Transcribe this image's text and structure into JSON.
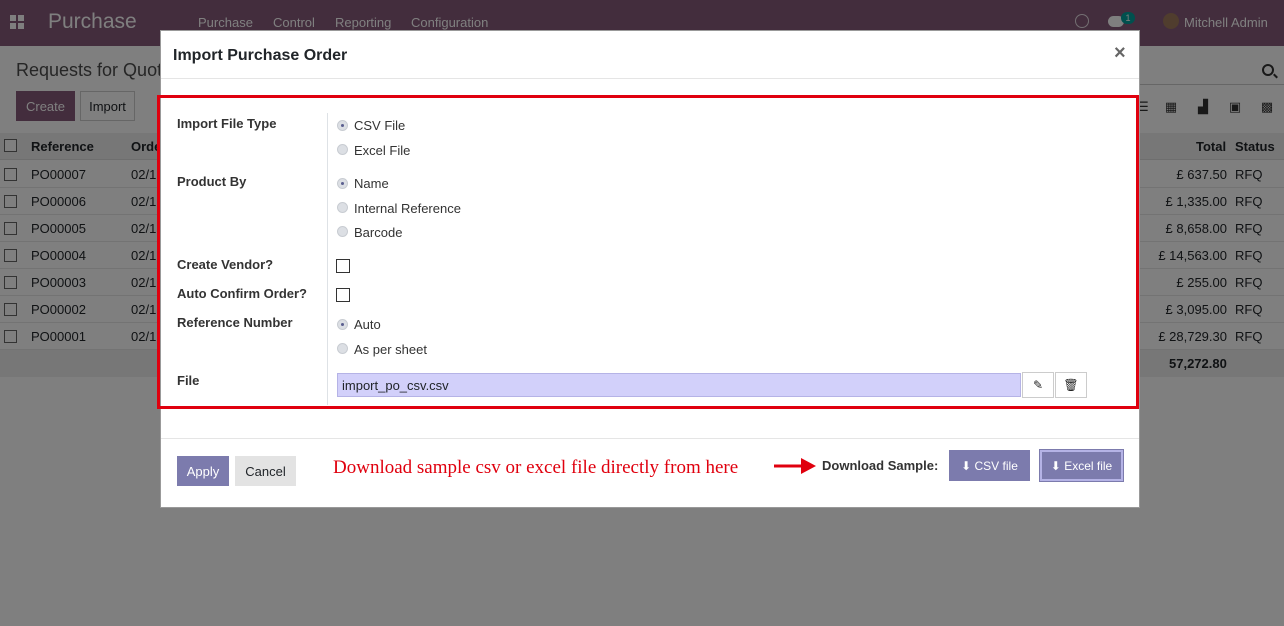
{
  "navbar": {
    "app_name": "Purchase",
    "menu": [
      "Purchase",
      "Control",
      "Reporting",
      "Configuration"
    ],
    "notification_count": "1",
    "user": "Mitchell Admin"
  },
  "control_panel": {
    "title": "Requests for Quot",
    "create_label": "Create",
    "import_label": "Import"
  },
  "list": {
    "headers": {
      "reference": "Reference",
      "order": "Orde",
      "total": "Total",
      "status": "Status"
    },
    "rows": [
      {
        "ref": "PO00007",
        "date": "02/1",
        "total": "£ 637.50",
        "status": "RFQ"
      },
      {
        "ref": "PO00006",
        "date": "02/1",
        "total": "£ 1,335.00",
        "status": "RFQ"
      },
      {
        "ref": "PO00005",
        "date": "02/1",
        "total": "£ 8,658.00",
        "status": "RFQ"
      },
      {
        "ref": "PO00004",
        "date": "02/1",
        "total": "£ 14,563.00",
        "status": "RFQ"
      },
      {
        "ref": "PO00003",
        "date": "02/1",
        "total": "£ 255.00",
        "status": "RFQ"
      },
      {
        "ref": "PO00002",
        "date": "02/1",
        "total": "£ 3,095.00",
        "status": "RFQ"
      },
      {
        "ref": "PO00001",
        "date": "02/1",
        "total": "£ 28,729.30",
        "status": "RFQ"
      }
    ],
    "grand_total": "57,272.80"
  },
  "modal": {
    "title": "Import Purchase Order",
    "close": "×",
    "import_file_type": {
      "label": "Import File Type",
      "options": [
        "CSV File",
        "Excel File"
      ],
      "selected": "CSV File"
    },
    "product_by": {
      "label": "Product By",
      "options": [
        "Name",
        "Internal Reference",
        "Barcode"
      ],
      "selected": "Name"
    },
    "create_vendor": {
      "label": "Create Vendor?",
      "checked": false
    },
    "auto_confirm": {
      "label": "Auto Confirm Order?",
      "checked": false
    },
    "reference_number": {
      "label": "Reference Number",
      "options": [
        "Auto",
        "As per sheet"
      ],
      "selected": "Auto"
    },
    "file": {
      "label": "File",
      "value": "import_po_csv.csv"
    },
    "footer": {
      "apply": "Apply",
      "cancel": "Cancel",
      "hint": "Download sample csv or excel file directly from here",
      "download_label": "Download Sample:",
      "csv_button": "CSV file",
      "excel_button": "Excel file"
    }
  },
  "colors": {
    "brand": "#875a7b",
    "button": "#7c7bad",
    "highlight": "#e0000e"
  }
}
